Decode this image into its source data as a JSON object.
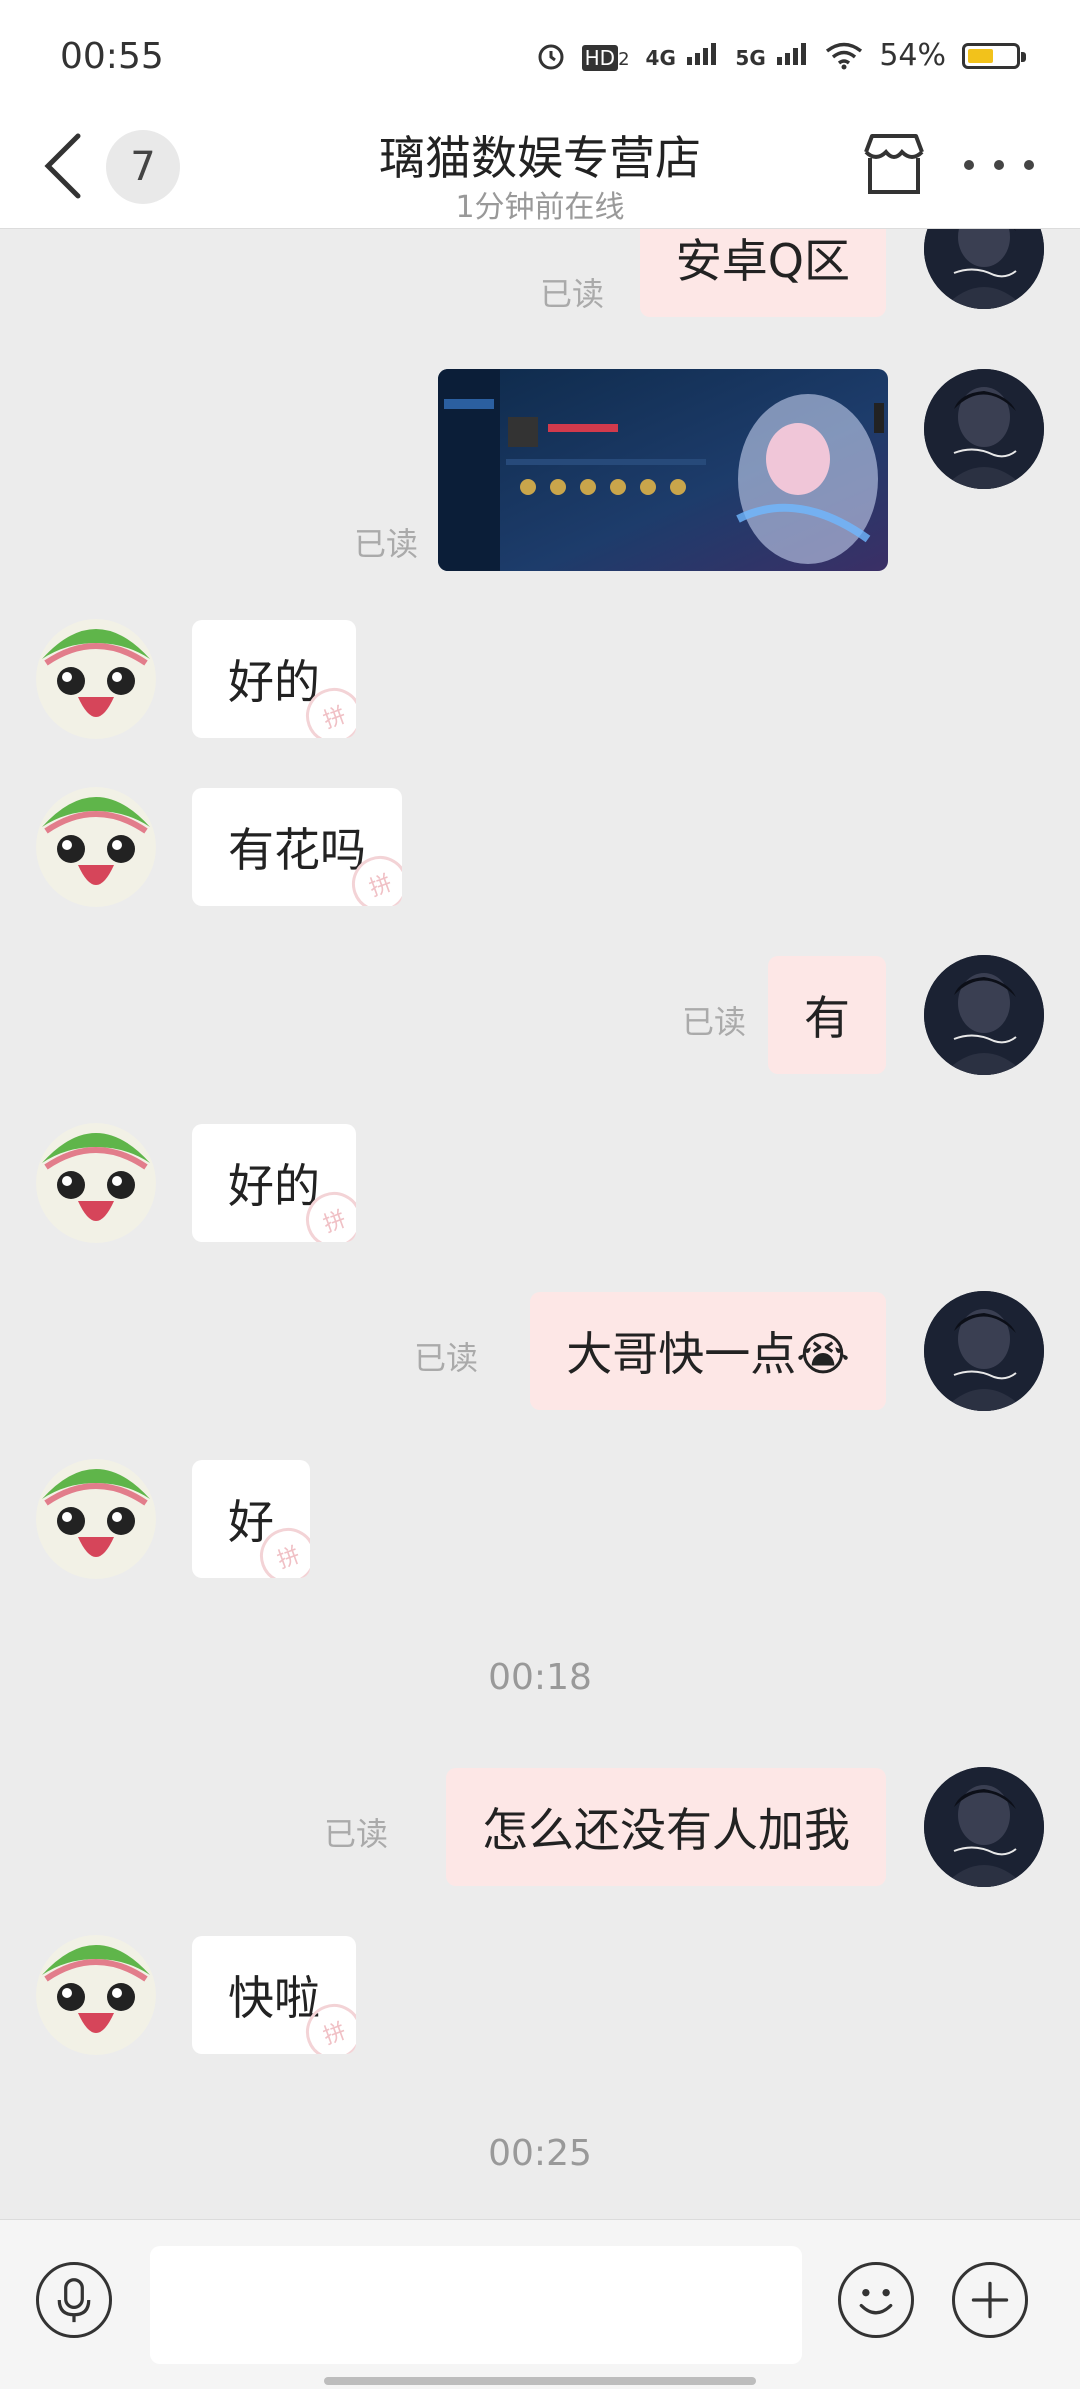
{
  "status_bar": {
    "time": "00:55",
    "battery_text": "54%",
    "battery_level": 0.54,
    "hd_label": "HD",
    "hd_sub": "2",
    "net1": "4G",
    "net2": "5G"
  },
  "header": {
    "unread_count": "7",
    "title": "璃猫数娱专营店",
    "subtitle": "1分钟前在线"
  },
  "read_label": "已读",
  "messages": [
    {
      "dir": "out",
      "text": "安卓Q区"
    },
    {
      "dir": "out",
      "type": "image"
    },
    {
      "dir": "in",
      "text": "好的"
    },
    {
      "dir": "in",
      "text": "有花吗"
    },
    {
      "dir": "out",
      "text": "有"
    },
    {
      "dir": "in",
      "text": "好的"
    },
    {
      "dir": "out",
      "text": "大哥快一点😭"
    },
    {
      "dir": "in",
      "text": "好"
    },
    {
      "type": "timestamp",
      "text": "00:18"
    },
    {
      "dir": "out",
      "text": "怎么还没有人加我"
    },
    {
      "dir": "in",
      "text": "快啦"
    },
    {
      "type": "timestamp",
      "text": "00:25"
    }
  ],
  "stamp_glyph": "拼",
  "input": {
    "value": "",
    "placeholder": ""
  },
  "colors": {
    "chat_bg": "#ececec",
    "bubble_out": "#fde7e6",
    "bubble_in": "#ffffff",
    "header_bg": "#ffffff"
  }
}
